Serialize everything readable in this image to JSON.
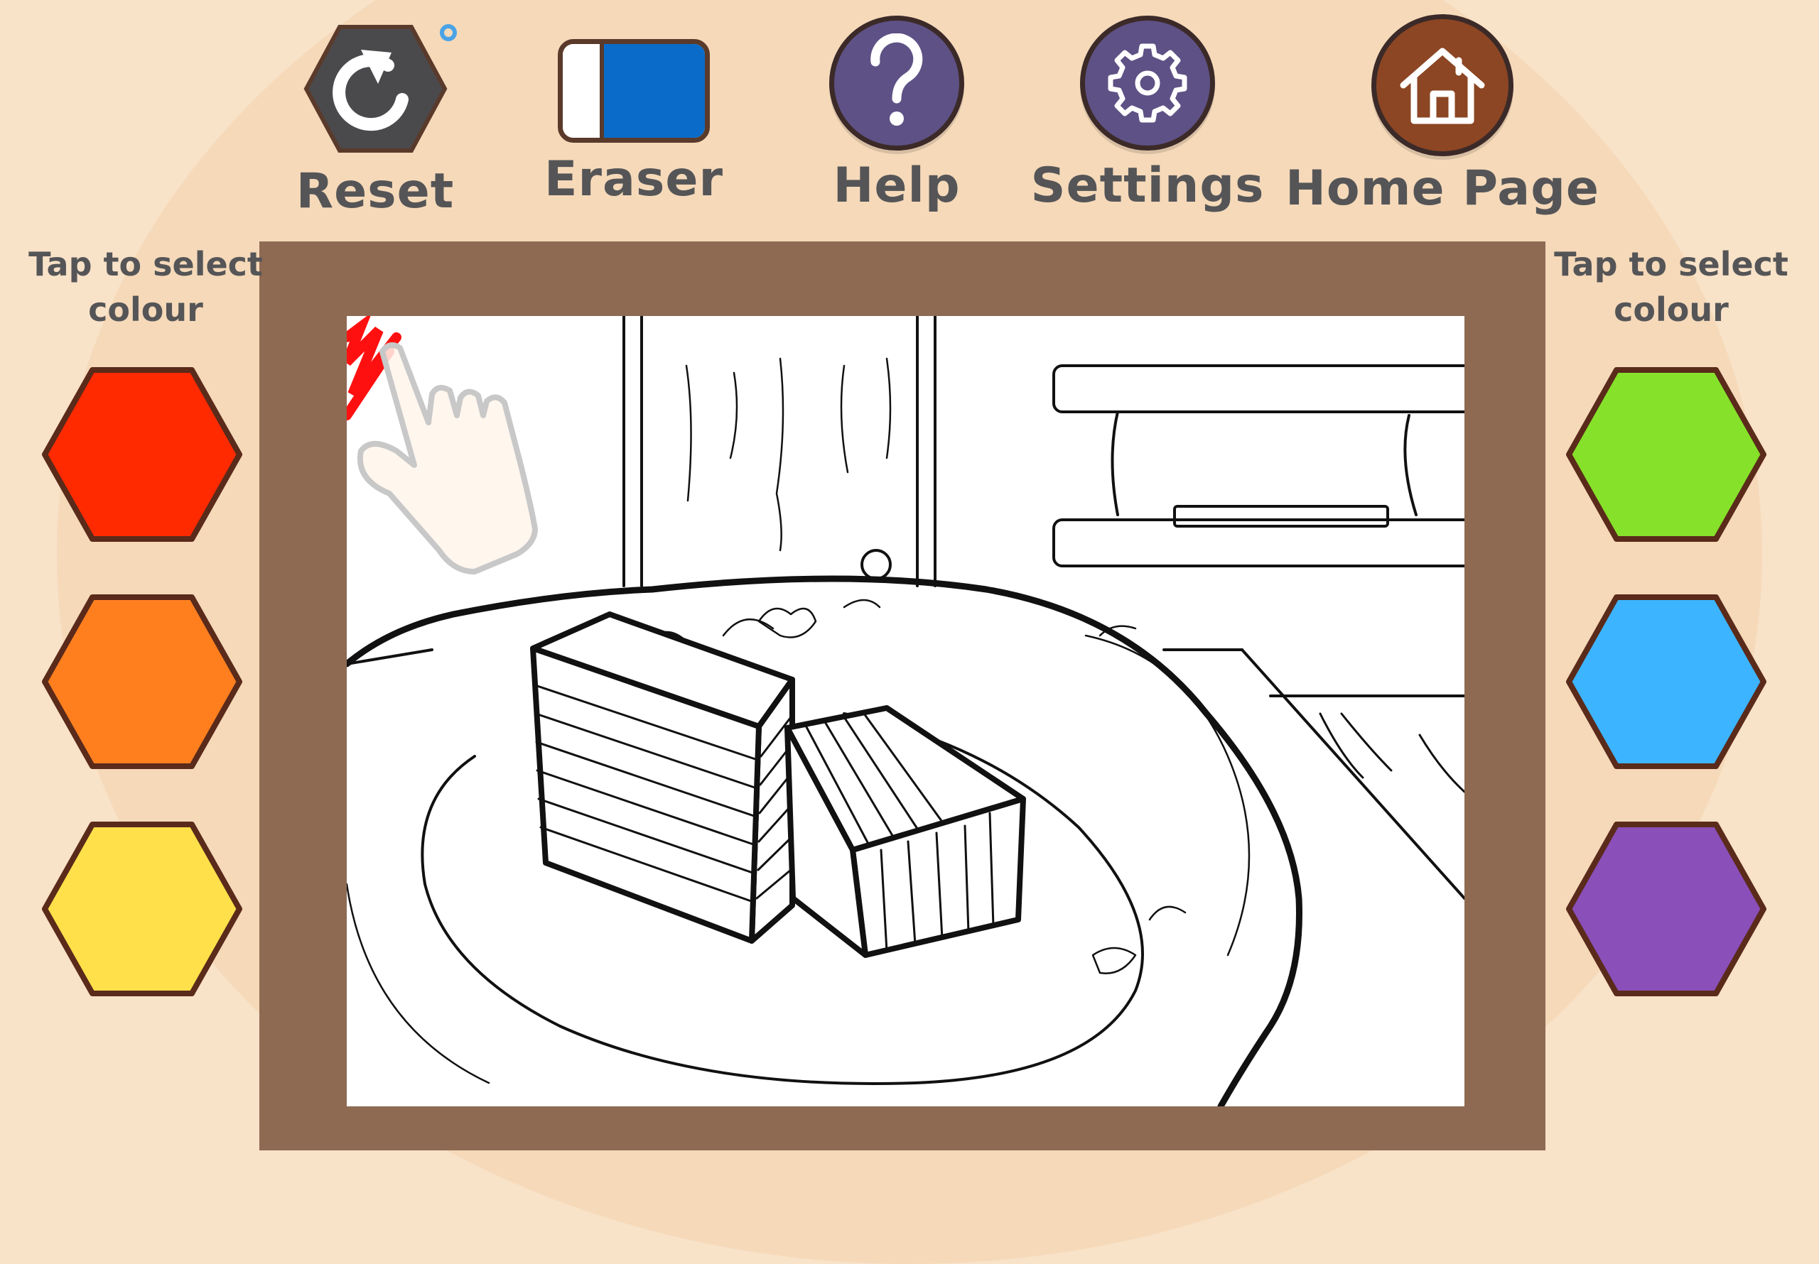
{
  "toolbar": {
    "reset_label": "Reset",
    "eraser_label": "Eraser",
    "help_label": "Help",
    "settings_label": "Settings",
    "home_label": "Home Page"
  },
  "left_panel": {
    "hint": "Tap to select colour",
    "colors": [
      {
        "name": "red",
        "hex": "#ff2a00"
      },
      {
        "name": "orange",
        "hex": "#ff7f1f"
      },
      {
        "name": "yellow",
        "hex": "#ffe04a"
      }
    ]
  },
  "right_panel": {
    "hint": "Tap to select colour",
    "colors": [
      {
        "name": "green",
        "hex": "#86e12a"
      },
      {
        "name": "blue",
        "hex": "#3db4ff"
      },
      {
        "name": "purple",
        "hex": "#8a4fb8"
      }
    ]
  },
  "icons": {
    "reset": "reset-icon",
    "eraser": "eraser-icon",
    "help": "question-mark-icon",
    "settings": "gear-icon",
    "home": "house-icon",
    "pointer": "tap-hand-icon"
  },
  "theme": {
    "background": "#f8e2c8",
    "frame": "#8e6a53",
    "reset_button": "#4a4a4d",
    "help_button": "#5e5185",
    "settings_button": "#5e5185",
    "home_button": "#8c4623",
    "eraser_blue": "#0a6cc8",
    "text": "#555557"
  }
}
